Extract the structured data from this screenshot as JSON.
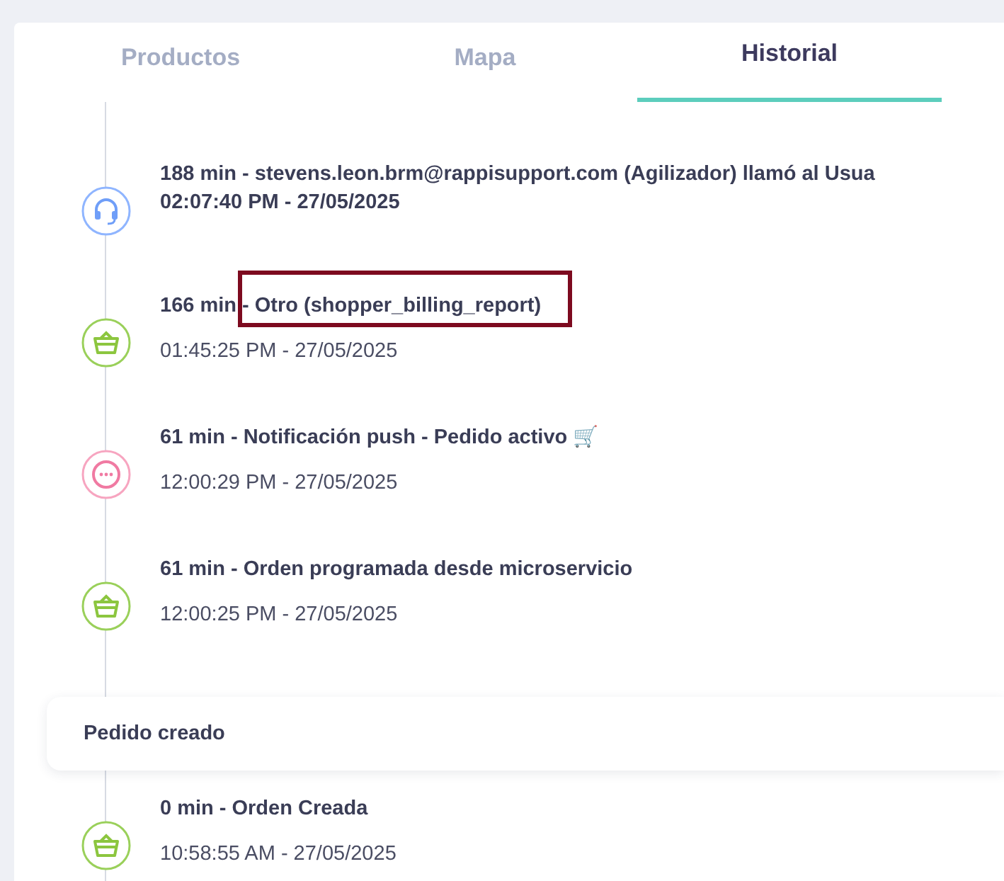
{
  "tabs": [
    {
      "label": "Productos",
      "selected": false
    },
    {
      "label": "Mapa",
      "selected": false
    },
    {
      "label": "Historial",
      "selected": true
    }
  ],
  "timeline": [
    {
      "kind": "call",
      "title": "188 min - stevens.leon.brm@rappisupport.com (Agilizador) llamó al Usua",
      "date": "02:07:40 PM - 27/05/2025",
      "date_bold": true,
      "highlighted": false
    },
    {
      "kind": "order",
      "title": "166 min - Otro (shopper_billing_report)",
      "date": "01:45:25 PM - 27/05/2025",
      "date_bold": false,
      "highlighted": true
    },
    {
      "kind": "push",
      "title": "61 min - Notificación push - Pedido activo 🛒",
      "date": "12:00:29 PM - 27/05/2025",
      "date_bold": false,
      "highlighted": false
    },
    {
      "kind": "order",
      "title": "61 min - Orden programada desde microservicio",
      "date": "12:00:25 PM - 27/05/2025",
      "date_bold": false,
      "highlighted": false
    },
    {
      "kind": "section",
      "title": "Pedido creado"
    },
    {
      "kind": "order",
      "title": "0 min - Orden Creada",
      "date": "10:58:55 AM - 27/05/2025",
      "date_bold": false,
      "highlighted": false
    }
  ]
}
